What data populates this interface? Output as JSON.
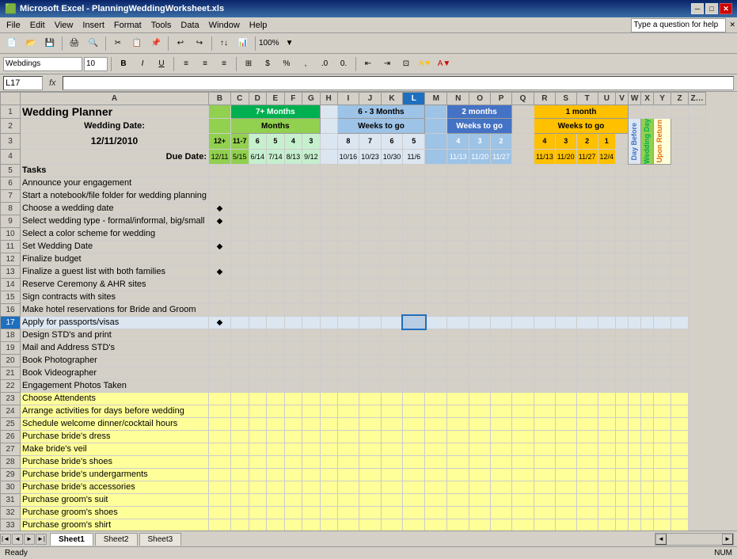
{
  "titleBar": {
    "icon": "excel-icon",
    "title": "Microsoft Excel - PlanningWeddingWorksheet.xls",
    "minimize": "─",
    "maximize": "□",
    "close": "✕"
  },
  "menuBar": {
    "items": [
      "File",
      "Edit",
      "View",
      "Insert",
      "Format",
      "Tools",
      "Data",
      "Window",
      "Help"
    ]
  },
  "toolbar": {
    "fontName": "Webdings",
    "fontSize": "10",
    "bold": "B",
    "italic": "I",
    "underline": "U"
  },
  "formulaBar": {
    "cellRef": "L17",
    "formula": ""
  },
  "spreadsheet": {
    "title": "Wedding Planner",
    "weddingDateLabel": "Wedding Date:",
    "weddingDate": "12/11/2010",
    "dueDateLabel": "Due Date:",
    "tasksLabel": "Tasks",
    "colHeaders": [
      "",
      "B",
      "C",
      "D",
      "E",
      "F",
      "G",
      "H",
      "I",
      "J",
      "K",
      "L",
      "M",
      "N",
      "O",
      "P",
      "Q",
      "R",
      "S",
      "T",
      "U",
      "V",
      "W",
      "X",
      "Y",
      "Z"
    ],
    "sections": {
      "sevenPlusMonths": "7+ Months",
      "sixToThreeMonths": "6 - 3 Months",
      "twoMonths": "2 months",
      "oneMonth": "1 month"
    },
    "subHeaders": {
      "months": "Months",
      "weeksToGo": "Weeks to go"
    },
    "monthNums": [
      "12+",
      "11-7",
      "6",
      "5",
      "4",
      "3",
      "8",
      "7",
      "6",
      "5",
      "4",
      "3",
      "2",
      "1"
    ],
    "dueDates": [
      "12/11",
      "5/15",
      "6/14",
      "7/14",
      "8/13",
      "9/12",
      "10/16",
      "10/23",
      "10/30",
      "11/6",
      "11/13",
      "11/20",
      "11/27",
      "12/4"
    ],
    "vertHeaders": [
      "Day Before",
      "Wedding Day",
      "Upon Return"
    ],
    "tasks": [
      {
        "row": 6,
        "label": "Announce your engagement",
        "diamonds": [],
        "cells": []
      },
      {
        "row": 7,
        "label": "Start a notebook/file folder for wedding planning",
        "diamonds": [],
        "cells": []
      },
      {
        "row": 8,
        "label": "Choose a wedding date",
        "diamonds": [
          "B"
        ],
        "cells": []
      },
      {
        "row": 9,
        "label": "Select wedding type - formal/informal, big/small",
        "diamonds": [
          "B"
        ],
        "cells": []
      },
      {
        "row": 10,
        "label": "Select a color scheme for wedding",
        "diamonds": [],
        "cells": []
      },
      {
        "row": 11,
        "label": "Set Wedding Date",
        "diamonds": [
          "B"
        ],
        "cells": []
      },
      {
        "row": 12,
        "label": "Finalize budget",
        "diamonds": [],
        "cells": []
      },
      {
        "row": 13,
        "label": "Finalize a guest list with both families",
        "diamonds": [
          "B"
        ],
        "cells": []
      },
      {
        "row": 14,
        "label": "Reserve Ceremony & AHR sites",
        "diamonds": [],
        "cells": []
      },
      {
        "row": 15,
        "label": "Sign contracts with sites",
        "diamonds": [],
        "cells": []
      },
      {
        "row": 16,
        "label": "Make hotel reservations for Bride and Groom",
        "diamonds": [],
        "cells": []
      },
      {
        "row": 17,
        "label": "Apply for passports/visas",
        "diamonds": [
          "B"
        ],
        "cells": [
          "L"
        ],
        "selected": true
      },
      {
        "row": 18,
        "label": "Design STD's and print",
        "diamonds": [],
        "cells": []
      },
      {
        "row": 19,
        "label": "Mail and Address STD's",
        "diamonds": [],
        "cells": []
      },
      {
        "row": 20,
        "label": "Book Photographer",
        "diamonds": [],
        "cells": []
      },
      {
        "row": 21,
        "label": "Book Videographer",
        "diamonds": [],
        "cells": []
      },
      {
        "row": 22,
        "label": "Engagement Photos Taken",
        "diamonds": [],
        "cells": []
      },
      {
        "row": 23,
        "label": "Choose Attendents",
        "diamonds": [],
        "cells": [],
        "bg": "yellow"
      },
      {
        "row": 24,
        "label": "Arrange activities for days before wedding",
        "diamonds": [],
        "cells": [],
        "bg": "yellow"
      },
      {
        "row": 25,
        "label": "Schedule welcome dinner/cocktail hours",
        "diamonds": [],
        "cells": [],
        "bg": "yellow"
      },
      {
        "row": 26,
        "label": "Purchase bride's dress",
        "diamonds": [],
        "cells": [],
        "bg": "yellow"
      },
      {
        "row": 27,
        "label": "Make bride's veil",
        "diamonds": [],
        "cells": [],
        "bg": "yellow"
      },
      {
        "row": 28,
        "label": "Purchase bride's shoes",
        "diamonds": [],
        "cells": [],
        "bg": "yellow"
      },
      {
        "row": 29,
        "label": "Purchase bride's undergarments",
        "diamonds": [],
        "cells": [],
        "bg": "yellow"
      },
      {
        "row": 30,
        "label": "Purchase bride's accessories",
        "diamonds": [],
        "cells": [],
        "bg": "yellow"
      },
      {
        "row": 31,
        "label": "Purchase groom's suit",
        "diamonds": [],
        "cells": [],
        "bg": "yellow"
      },
      {
        "row": 32,
        "label": "Purchase groom's shoes",
        "diamonds": [],
        "cells": [],
        "bg": "yellow"
      },
      {
        "row": 33,
        "label": "Purchase groom's shirt",
        "diamonds": [],
        "cells": [],
        "bg": "yellow"
      }
    ]
  },
  "sheetTabs": [
    "Sheet1",
    "Sheet2",
    "Sheet3"
  ],
  "activeSheet": "Sheet1",
  "statusBar": {
    "ready": "Ready",
    "num": "NUM"
  }
}
